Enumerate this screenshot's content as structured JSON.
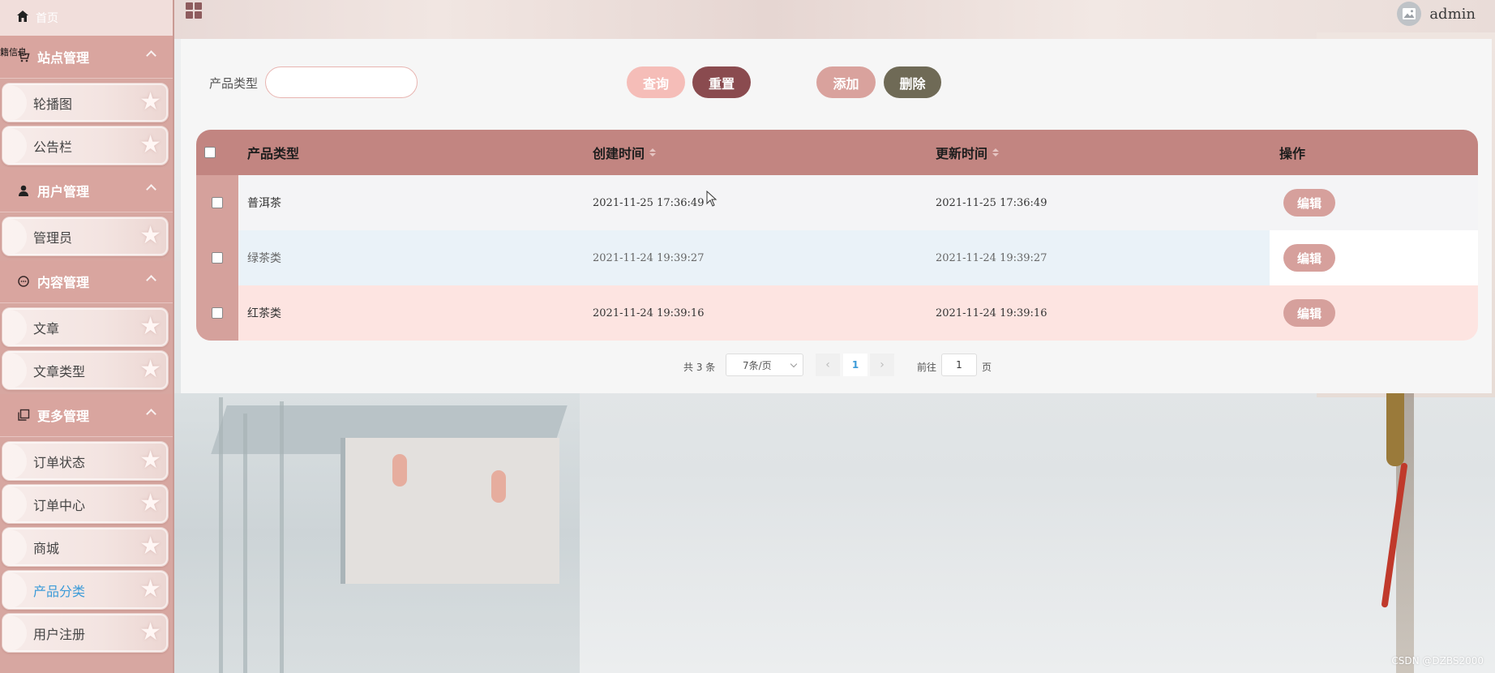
{
  "sidebar": {
    "home_label": "首页",
    "groups": [
      {
        "label": "站点管理",
        "icon": "cart-icon",
        "items": [
          "轮播图",
          "公告栏"
        ]
      },
      {
        "label": "用户管理",
        "icon": "person-icon",
        "items": [
          "管理员"
        ]
      },
      {
        "label": "内容管理",
        "icon": "chat-icon",
        "items": [
          "文章",
          "文章类型"
        ]
      },
      {
        "label": "更多管理",
        "icon": "copy-icon",
        "items": [
          "订单状态",
          "订单中心",
          "商城",
          "产品分类",
          "用户注册"
        ]
      }
    ],
    "active_item": "产品分类",
    "stray_label": "籍信息"
  },
  "topbar": {
    "user_name": "admin"
  },
  "search": {
    "label": "产品类型",
    "placeholder": ""
  },
  "buttons": {
    "query": "查询",
    "reset": "重置",
    "add": "添加",
    "delete": "删除"
  },
  "table": {
    "columns": [
      "产品类型",
      "创建时间",
      "更新时间",
      "操作"
    ],
    "rows": [
      {
        "type": "普洱茶",
        "created": "2021-11-25 17:36:49",
        "updated": "2021-11-25 17:36:49",
        "action": "编辑"
      },
      {
        "type": "绿茶类",
        "created": "2021-11-24 19:39:27",
        "updated": "2021-11-24 19:39:27",
        "action": "编辑"
      },
      {
        "type": "红茶类",
        "created": "2021-11-24 19:39:16",
        "updated": "2021-11-24 19:39:16",
        "action": "编辑"
      }
    ]
  },
  "pagination": {
    "total_text": "共 3 条",
    "page_size": "7条/页",
    "current_page": "1",
    "goto_label": "前往",
    "goto_value": "1",
    "page_unit": "页"
  },
  "watermark": "CSDN @DZBS2000",
  "colors": {
    "accent_link": "#3c9bd8",
    "header": "#c28581",
    "reset": "#8a4b4f",
    "delete": "#6f6a56"
  }
}
